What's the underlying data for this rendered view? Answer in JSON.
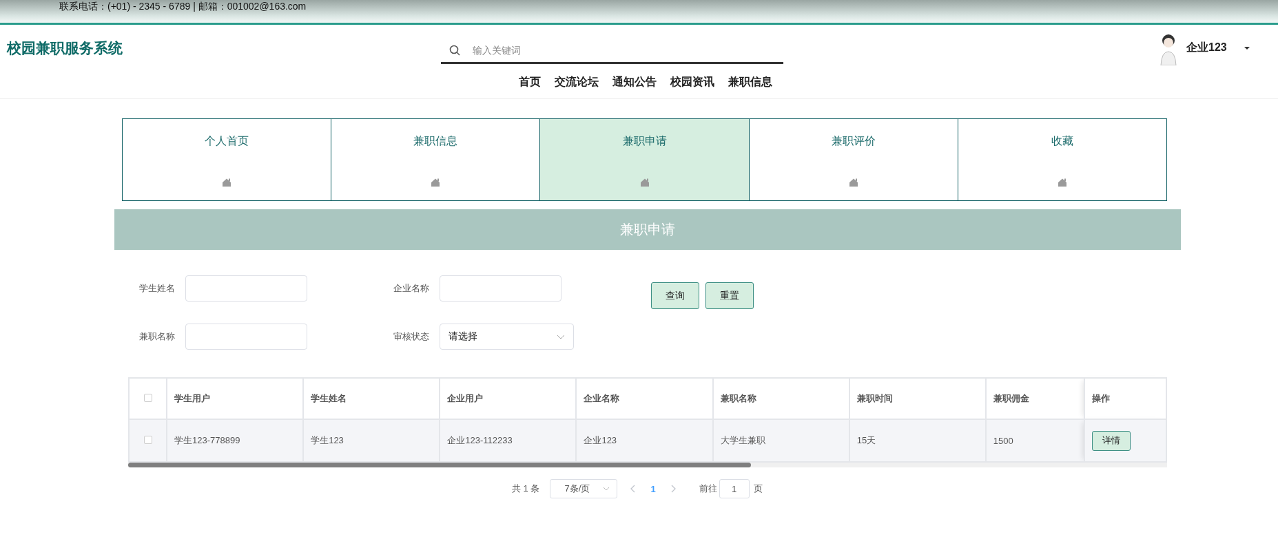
{
  "top_bar": {
    "contact": "联系电话：(+01) - 2345 - 6789 | 邮箱：001002@163.com"
  },
  "header": {
    "logo": "校园兼职服务系统",
    "search": {
      "placeholder": "输入关键词"
    },
    "user": "企业123"
  },
  "nav": [
    {
      "label": "首页"
    },
    {
      "label": "交流论坛"
    },
    {
      "label": "通知公告"
    },
    {
      "label": "校园资讯"
    },
    {
      "label": "兼职信息"
    }
  ],
  "tabs": [
    {
      "label": "个人首页",
      "selected": false
    },
    {
      "label": "兼职信息",
      "selected": false
    },
    {
      "label": "兼职申请",
      "selected": true
    },
    {
      "label": "兼职评价",
      "selected": false
    },
    {
      "label": "收藏",
      "selected": false
    }
  ],
  "section_title": "兼职申请",
  "filters": [
    {
      "kind": "text",
      "label": "学生姓名"
    },
    {
      "kind": "text",
      "label": "企业名称"
    },
    {
      "kind": "text",
      "label": "兼职名称"
    },
    {
      "kind": "select",
      "label": "审核状态",
      "value": "请选择"
    }
  ],
  "buttons": [
    "查询",
    "重置"
  ],
  "table": {
    "header_checked": false,
    "columns": [
      "学生用户",
      "学生姓名",
      "企业用户",
      "企业名称",
      "兼职名称",
      "兼职时间",
      "兼职佣金",
      "操作"
    ],
    "rows": [
      {
        "checked": false,
        "cells": [
          "学生123-778899",
          "学生123",
          "企业123-112233",
          "企业123",
          "大学生兼职",
          "15天",
          "1500"
        ],
        "action": "详情"
      }
    ]
  },
  "pagination": {
    "total": "共 1 条",
    "page_size": "7条/页",
    "pages": [
      {
        "label": "1",
        "selected": true
      }
    ],
    "goto_label": "前往",
    "goto_value": "1",
    "goto_suffix": "页"
  }
}
